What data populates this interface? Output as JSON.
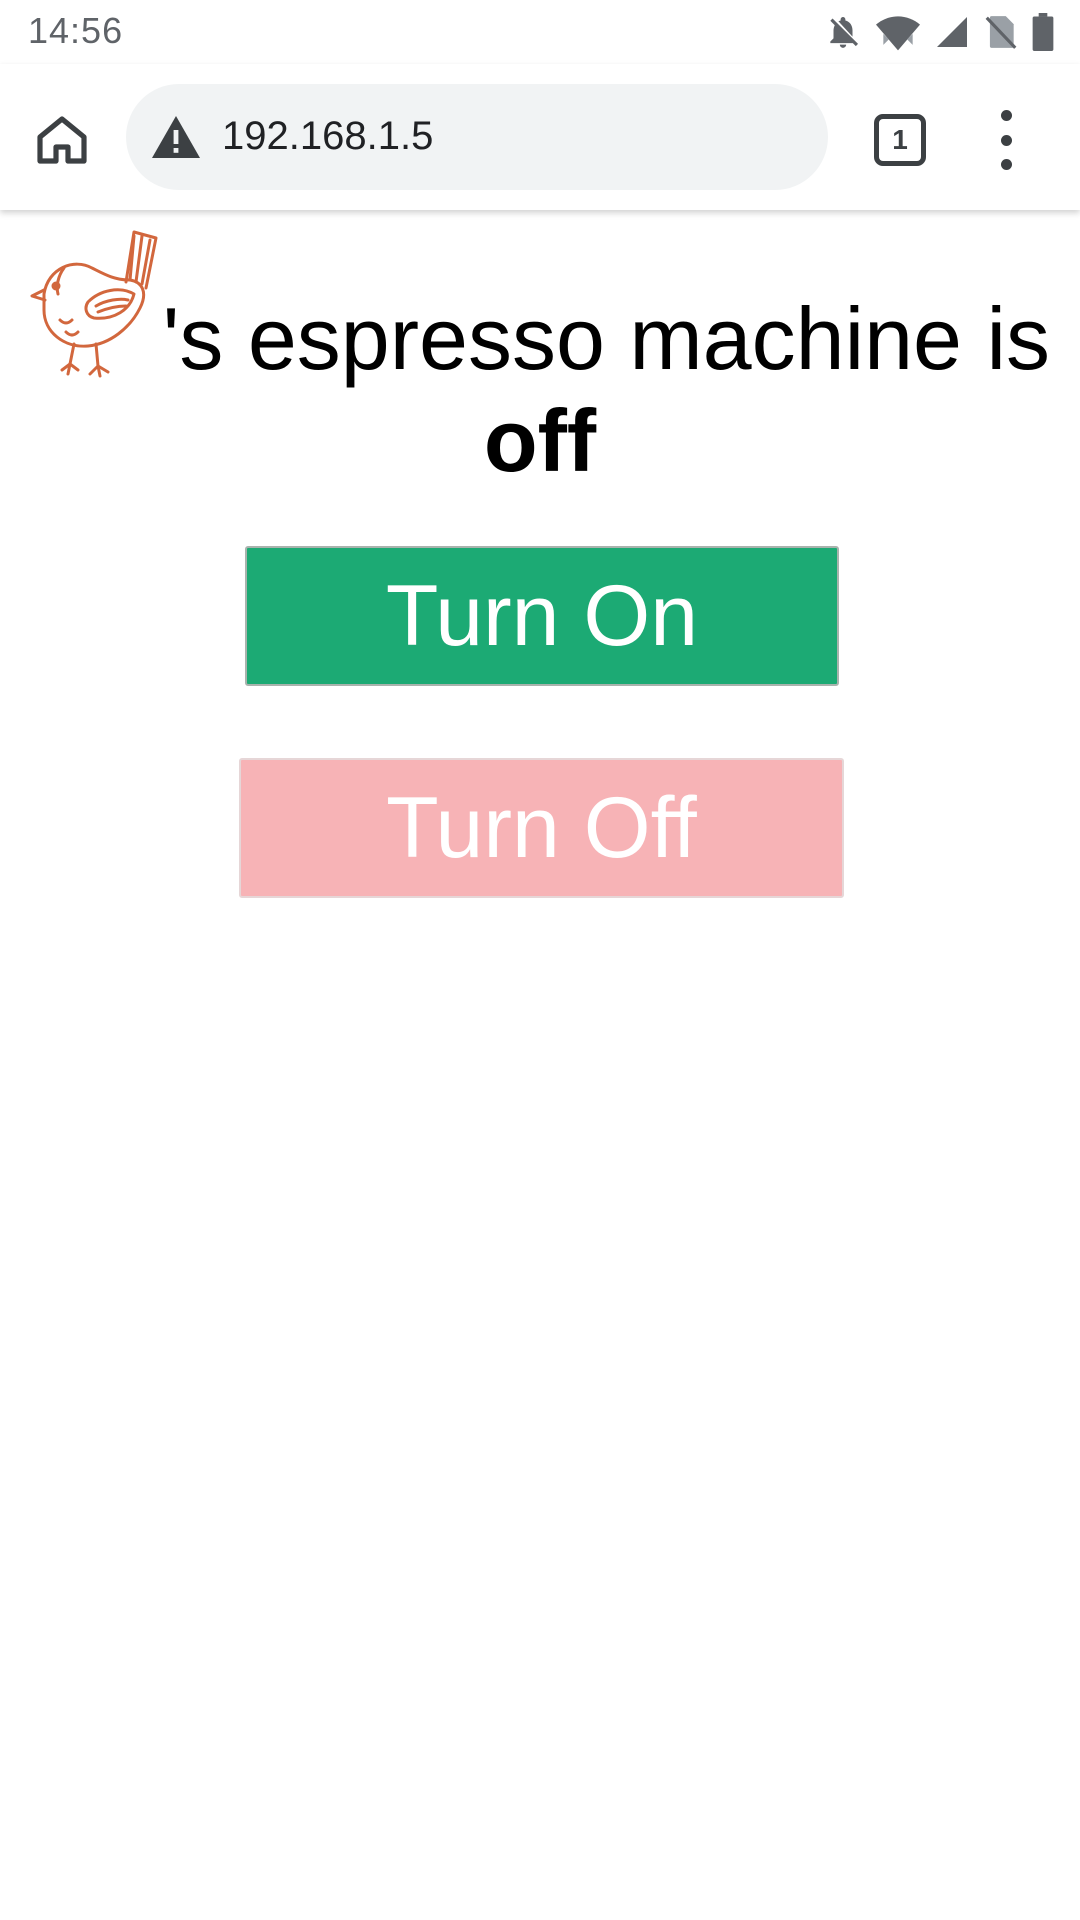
{
  "status_bar": {
    "time": "14:56",
    "icons": [
      "notifications-off-icon",
      "wifi-icon",
      "cellular-signal-icon",
      "no-sim-icon",
      "battery-icon"
    ]
  },
  "browser": {
    "url": "192.168.1.5",
    "tab_count": "1",
    "icons": [
      "home-icon",
      "not-secure-warning-icon",
      "tab-switcher-icon",
      "overflow-menu-icon"
    ]
  },
  "page": {
    "heading_text": "'s espresso machine is",
    "state": "off",
    "turn_on_label": "Turn On",
    "turn_off_label": "Turn Off"
  },
  "colors": {
    "turn_on": "#1caa74",
    "turn_off": "#f7b3b6",
    "bird_logo": "#d2673d"
  }
}
